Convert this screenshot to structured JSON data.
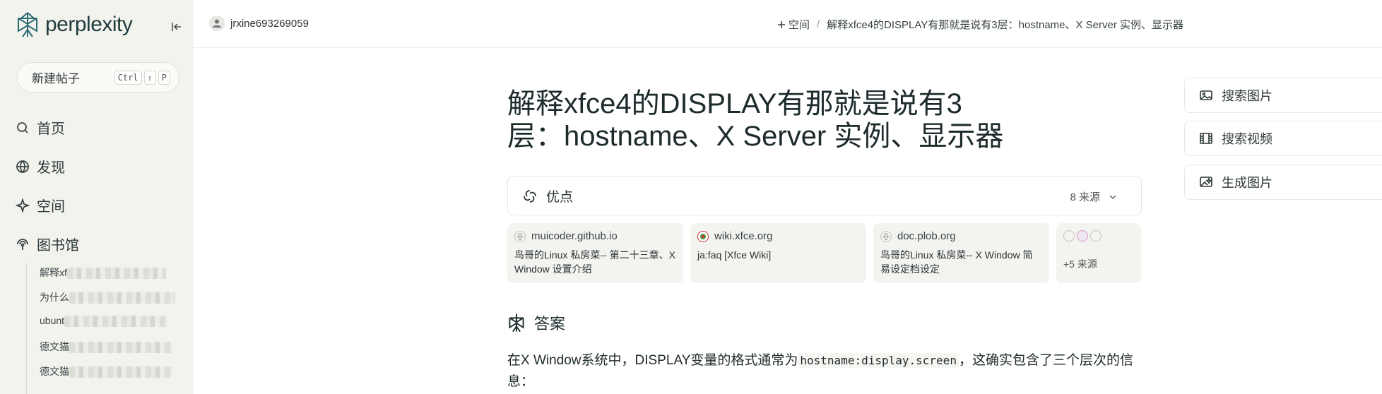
{
  "sidebar": {
    "logo_text": "perplexity",
    "new_post": {
      "label": "新建帖子",
      "keys": [
        "Ctrl",
        "⇧",
        "P"
      ]
    },
    "nav": [
      {
        "label": "首页",
        "icon": "search-icon"
      },
      {
        "label": "发现",
        "icon": "globe-icon"
      },
      {
        "label": "空间",
        "icon": "sparkle-icon"
      },
      {
        "label": "图书馆",
        "icon": "library-icon"
      }
    ],
    "library_items": [
      "解释xf",
      "为什么",
      "ubunt",
      "德文猫",
      "德文猫"
    ]
  },
  "topbar": {
    "username": "jrxine693269059",
    "crumb_space": "空间",
    "crumb_sep": "/",
    "crumb_title": "解释xfce4的DISPLAY有那就是说有3层：hostname、X Server 实例、显示器"
  },
  "main": {
    "title": "解释xfce4的DISPLAY有那就是说有3层：hostname、X Server 实例、显示器",
    "sources_bar": {
      "label": "优点",
      "count": "8 来源"
    },
    "sources": [
      {
        "host": "muicoder.github.io",
        "desc": "鸟哥的Linux 私房菜-- 第二十三章、X Window 设置介绍"
      },
      {
        "host": "wiki.xfce.org",
        "desc": "ja:faq [Xfce Wiki]"
      },
      {
        "host": "doc.plob.org",
        "desc": "鸟哥的Linux 私房菜-- X Window 简易设定档设定"
      }
    ],
    "more_sources": {
      "label": "+5  来源"
    },
    "answer_heading": "答案",
    "answer_text_before": "在X Window系统中，DISPLAY变量的格式通常为",
    "answer_code": "hostname:display.screen",
    "answer_text_after": "，这确实包含了三个层次的信息："
  },
  "right": {
    "buttons": [
      "搜索图片",
      "搜索视频",
      "生成图片"
    ]
  },
  "colors": {
    "sidebar_bg": "#f3f3ee",
    "brand": "#1f3b3e",
    "card_bg": "#f3f3ef"
  }
}
